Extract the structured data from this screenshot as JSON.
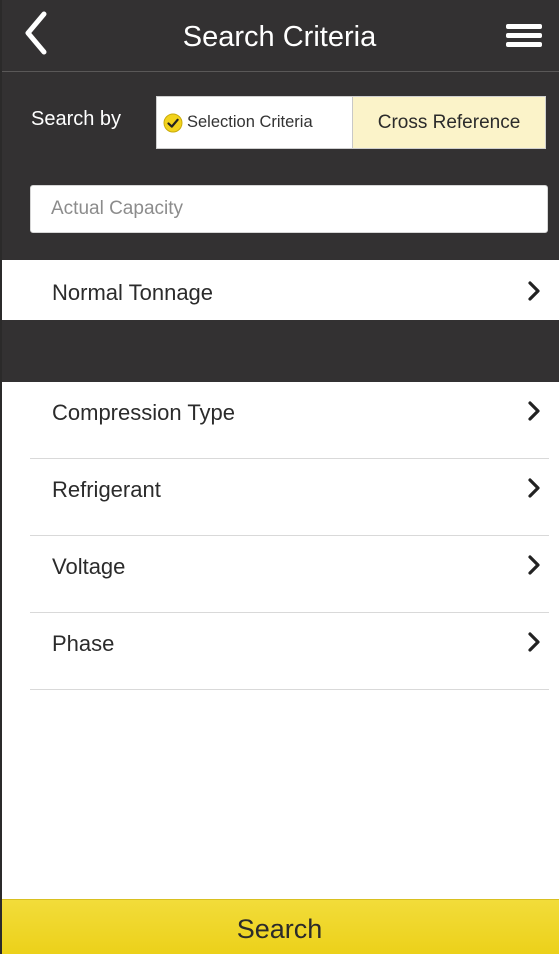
{
  "nav": {
    "title": "Search Criteria",
    "back_icon": "chevron-left-icon",
    "menu_icon": "hamburger-menu-icon"
  },
  "search_by": {
    "label": "Search by",
    "options": [
      {
        "label": "Selection Criteria",
        "selected": true,
        "icon": "check-circle-icon"
      },
      {
        "label": "Cross Reference",
        "selected": false
      }
    ]
  },
  "capacity": {
    "placeholder": "Actual Capacity",
    "value": ""
  },
  "tonnage": {
    "label": "Normal Tonnage"
  },
  "criteria": [
    {
      "label": "Compression Type"
    },
    {
      "label": "Refrigerant"
    },
    {
      "label": "Voltage"
    },
    {
      "label": "Phase"
    }
  ],
  "search_button": {
    "label": "Search"
  },
  "colors": {
    "header_bg": "#333132",
    "accent_yellow": "#f0d72b",
    "segment_highlight": "#fbf3c9"
  }
}
